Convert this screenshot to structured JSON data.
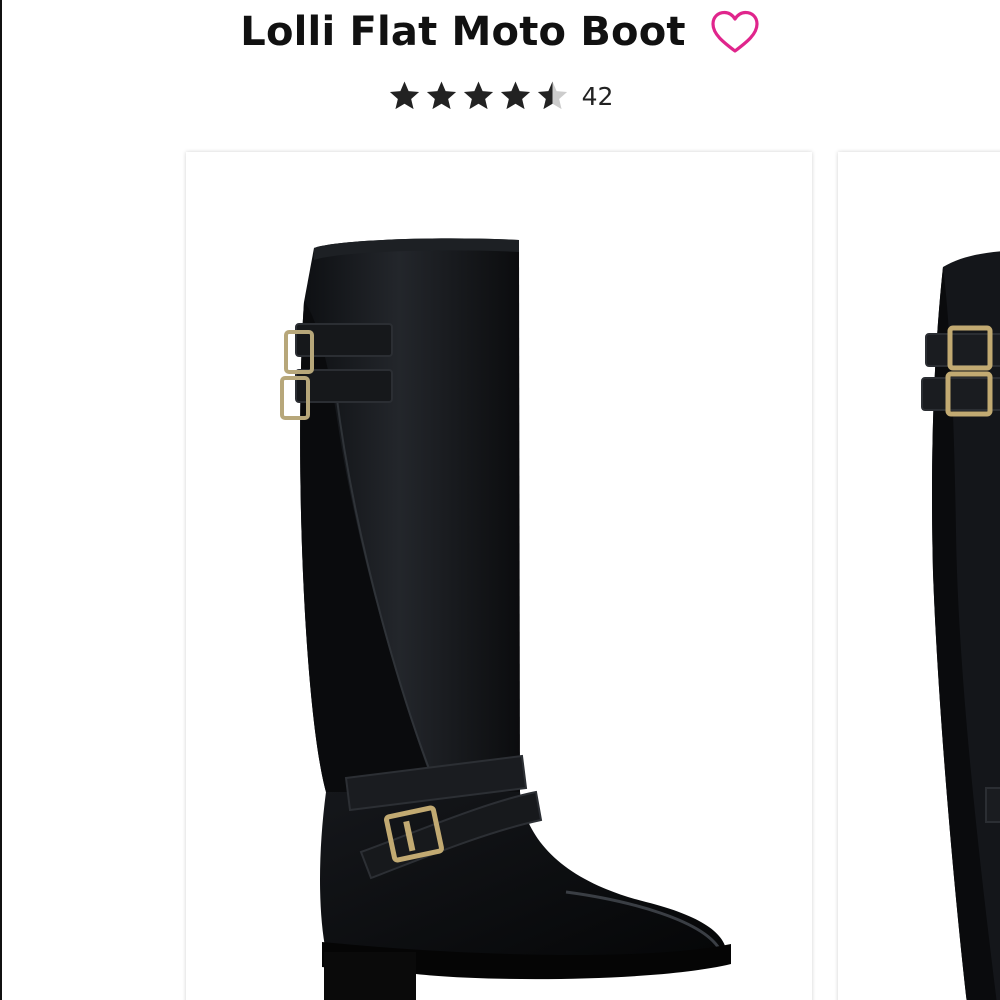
{
  "product": {
    "title": "Lolli Flat Moto Boot",
    "favorite_icon": "heart-outline-icon",
    "rating": {
      "value": 4.5,
      "max": 5,
      "review_count": "42"
    }
  },
  "gallery": {
    "images": [
      {
        "name": "boot-side-view-image"
      },
      {
        "name": "boot-alternate-view-image"
      }
    ]
  },
  "colors": {
    "accent": "#e0258c",
    "star_filled": "#222222",
    "star_empty": "#cccccc",
    "title": "#111111"
  }
}
